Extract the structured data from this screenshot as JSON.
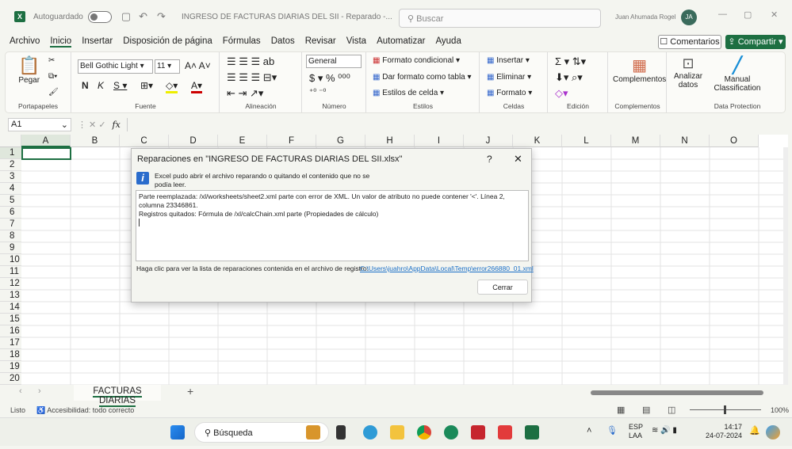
{
  "titlebar": {
    "autosave": "Autoguardado",
    "doc_title": "INGRESO DE FACTURAS DIARIAS DEL SII  -  Reparado  -...",
    "search_placeholder": "Buscar",
    "user": "Juan Ahumada Rogel",
    "initials": "JA"
  },
  "menu": {
    "items": [
      "Archivo",
      "Inicio",
      "Insertar",
      "Disposición de página",
      "Fórmulas",
      "Datos",
      "Revisar",
      "Vista",
      "Automatizar",
      "Ayuda"
    ],
    "comments": "Comentarios",
    "share": "Compartir"
  },
  "ribbon": {
    "paste": "Pegar",
    "font_name": "Bell Gothic Light",
    "font_size": "11",
    "number_format": "General",
    "styles": [
      "Formato condicional",
      "Dar formato como tabla",
      "Estilos de celda"
    ],
    "cells": [
      "Insertar",
      "Eliminar",
      "Formato"
    ],
    "addins": "Complementos",
    "analyze": "Analizar datos",
    "manual": "Manual Classification",
    "groups": [
      "Portapapeles",
      "Fuente",
      "Alineación",
      "Número",
      "Estilos",
      "Celdas",
      "Edición",
      "Complementos",
      "Data Protection"
    ]
  },
  "formula_bar": {
    "name_box": "A1",
    "fx": "fx"
  },
  "columns": [
    "A",
    "B",
    "C",
    "D",
    "E",
    "F",
    "G",
    "H",
    "I",
    "J",
    "K",
    "L",
    "M",
    "N",
    "O"
  ],
  "rows": [
    "1",
    "2",
    "3",
    "4",
    "5",
    "6",
    "7",
    "8",
    "9",
    "10",
    "11",
    "12",
    "13",
    "14",
    "15",
    "16",
    "17",
    "18",
    "19",
    "20"
  ],
  "dialog": {
    "title": "Reparaciones en \"INGRESO DE FACTURAS DIARIAS DEL SII.xlsx\"",
    "help": "?",
    "close": "✕",
    "message": "Excel pudo abrir el archivo reparando o quitando el contenido que no se podía leer.",
    "details": [
      "Parte reemplazada: /xl/worksheets/sheet2.xml parte con error de XML.  Un valor de atributo no puede contener '<'. Línea 2, columna 23346861.",
      "Registros quitados: Fórmula de /xl/calcChain.xml parte (Propiedades de cálculo)"
    ],
    "log_label": "Haga clic para ver la lista de reparaciones contenida en el archivo de registro:",
    "log_link": "C:\\Users\\juahro\\AppData\\Local\\Temp\\error266880_01.xml",
    "close_button": "Cerrar"
  },
  "sheet_tabs": {
    "active": "FACTURAS DIARIAS",
    "add": "+"
  },
  "status": {
    "ready": "Listo",
    "accessibility": "Accesibilidad: todo correcto",
    "zoom": "100%"
  },
  "taskbar": {
    "search": "Búsqueda",
    "lang1": "ESP",
    "lang2": "LAA",
    "time": "14:17",
    "date": "24-07-2024"
  }
}
